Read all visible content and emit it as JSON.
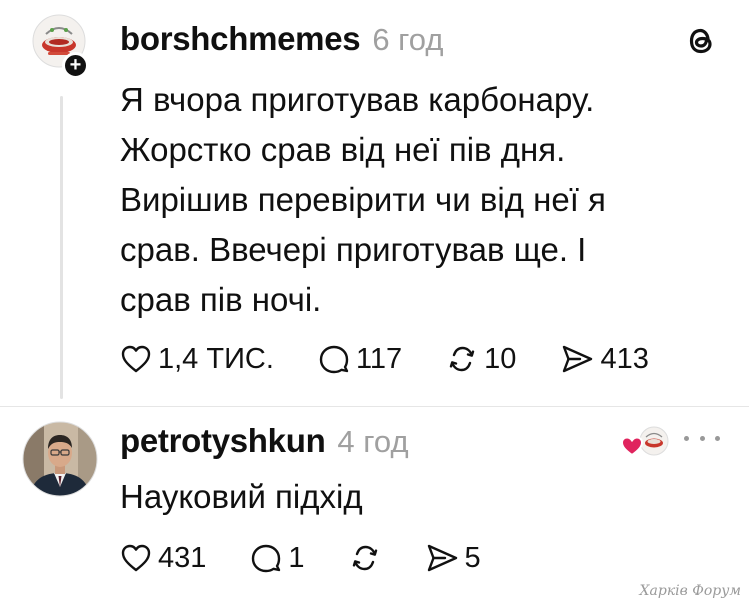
{
  "post": {
    "username": "borshchmemes",
    "timestamp": "6 год",
    "text_lines": [
      "Я вчора приготував карбонару.",
      "Жорстко срав від неї пів дня.",
      "Вирішив перевірити чи від неї я",
      "срав. Ввечері приготував ще. І",
      "срав пів ночі."
    ],
    "stats": {
      "likes": "1,4 ТИС.",
      "comments": "117",
      "reposts": "10",
      "shares": "413"
    },
    "icons": {
      "avatar": "borshch-logo-avatar",
      "follow": "plus-icon",
      "platform": "threads-logo-icon"
    }
  },
  "reply": {
    "username": "petrotyshkun",
    "timestamp": "4 год",
    "text": "Науковий підхід",
    "stats": {
      "likes": "431",
      "comments": "1",
      "shares": "5"
    },
    "icons": {
      "avatar": "man-portrait-avatar",
      "liked_by_author": "heart-with-borshch-avatar",
      "more": "ellipsis-icon"
    }
  },
  "watermark": "Харків Форум",
  "colors": {
    "text": "#101010",
    "muted": "#a0a0a0",
    "heart": "#e0245e",
    "thread_line": "#e3e3e3"
  }
}
